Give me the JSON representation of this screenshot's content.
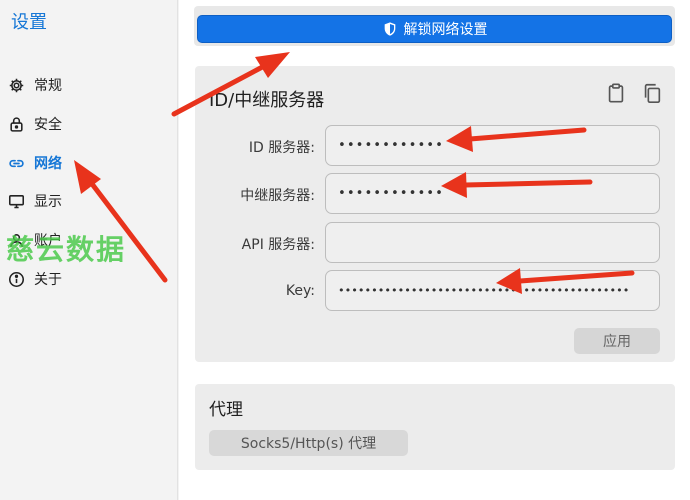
{
  "sidebar": {
    "title": "设置",
    "items": [
      {
        "label": "常规",
        "icon": "gear-icon",
        "active": false
      },
      {
        "label": "安全",
        "icon": "lock-icon",
        "active": false
      },
      {
        "label": "网络",
        "icon": "link-icon",
        "active": true
      },
      {
        "label": "显示",
        "icon": "monitor-icon",
        "active": false
      },
      {
        "label": "账户",
        "icon": "user-icon",
        "active": false
      },
      {
        "label": "关于",
        "icon": "info-icon",
        "active": false
      }
    ]
  },
  "main": {
    "unlock_button": {
      "label": "解锁网络设置",
      "icon": "shield-icon"
    },
    "server_card": {
      "title": "ID/中继服务器",
      "tools": [
        "clipboard-icon",
        "copy-icon"
      ],
      "fields": [
        {
          "label": "ID 服务器:",
          "value": "••••••••••••"
        },
        {
          "label": "中继服务器:",
          "value": "••••••••••••"
        },
        {
          "label": "API 服务器:",
          "value": ""
        },
        {
          "label": "Key:",
          "value": "••••••••••••••••••••••••••••••••••••••••••••"
        }
      ],
      "apply_label": "应用"
    },
    "proxy_card": {
      "title": "代理",
      "button_label": "Socks5/Http(s) 代理"
    }
  },
  "watermark": "慈云数据",
  "colors": {
    "accent": "#1677d6",
    "button_blue": "#1473e6",
    "annotation_red": "#e8331c",
    "watermark_green": "#46c846"
  }
}
